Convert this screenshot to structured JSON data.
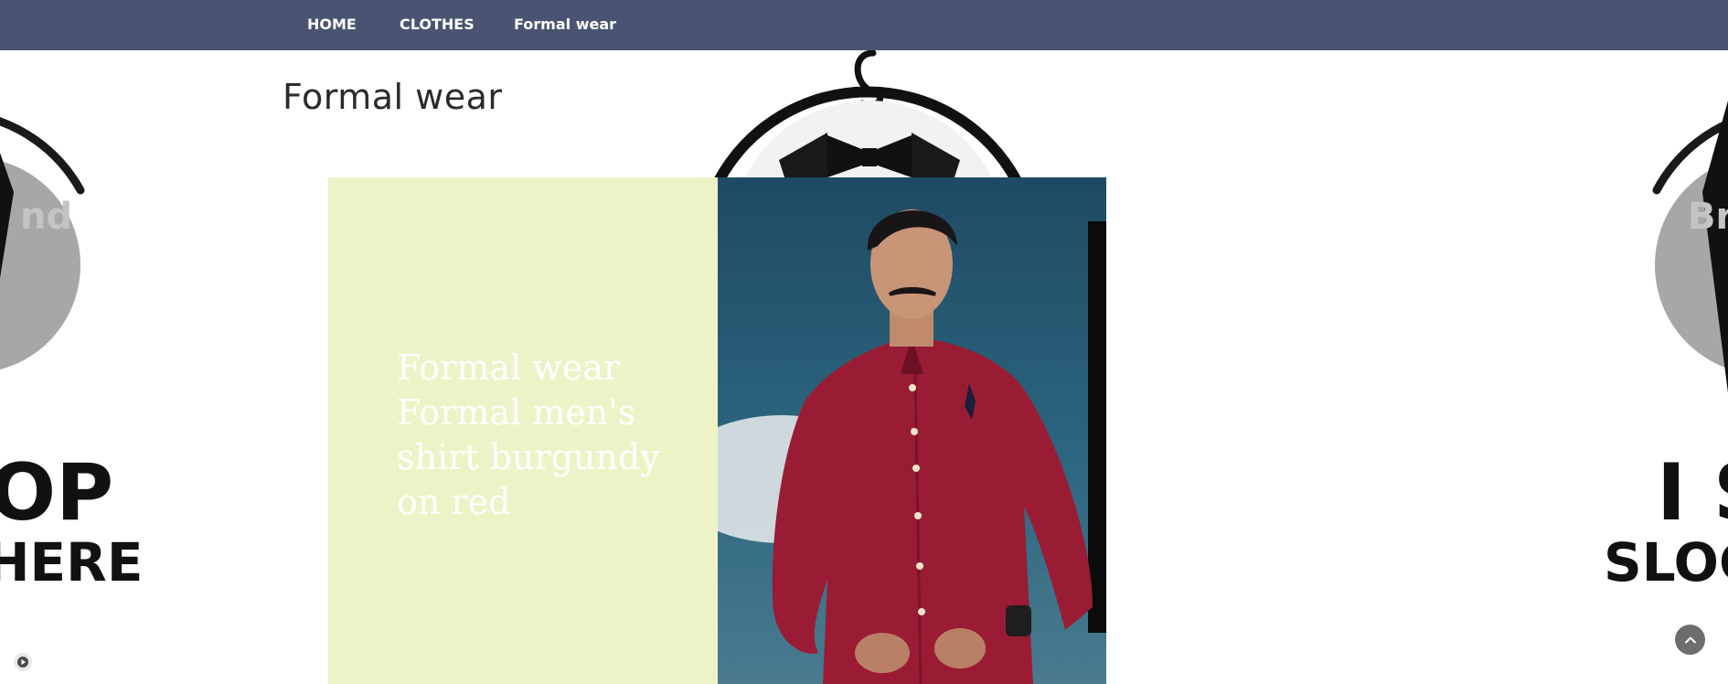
{
  "nav": {
    "items": [
      {
        "label": "HOME"
      },
      {
        "label": "CLOTHES"
      },
      {
        "label": "Formal wear"
      }
    ]
  },
  "page": {
    "title": "Formal wear"
  },
  "card": {
    "caption": "Formal wear Formal men's shirt burgundy on red",
    "photo_subject": "man-in-burgundy-shirt"
  },
  "background_logo": {
    "left_text_line1": "OP",
    "left_text_line2": "HERE",
    "right_text_line1": "I S",
    "right_text_line2": "SLOG",
    "left_watermark": "nd",
    "right_watermark": "Br"
  },
  "controls": {
    "back_to_top_icon": "chevron-up-icon",
    "cookie_icon": "play-icon"
  },
  "colors": {
    "nav_bg": "#4a5472",
    "card_bg": "#eef3c7",
    "title_color": "#2b2b2b"
  }
}
